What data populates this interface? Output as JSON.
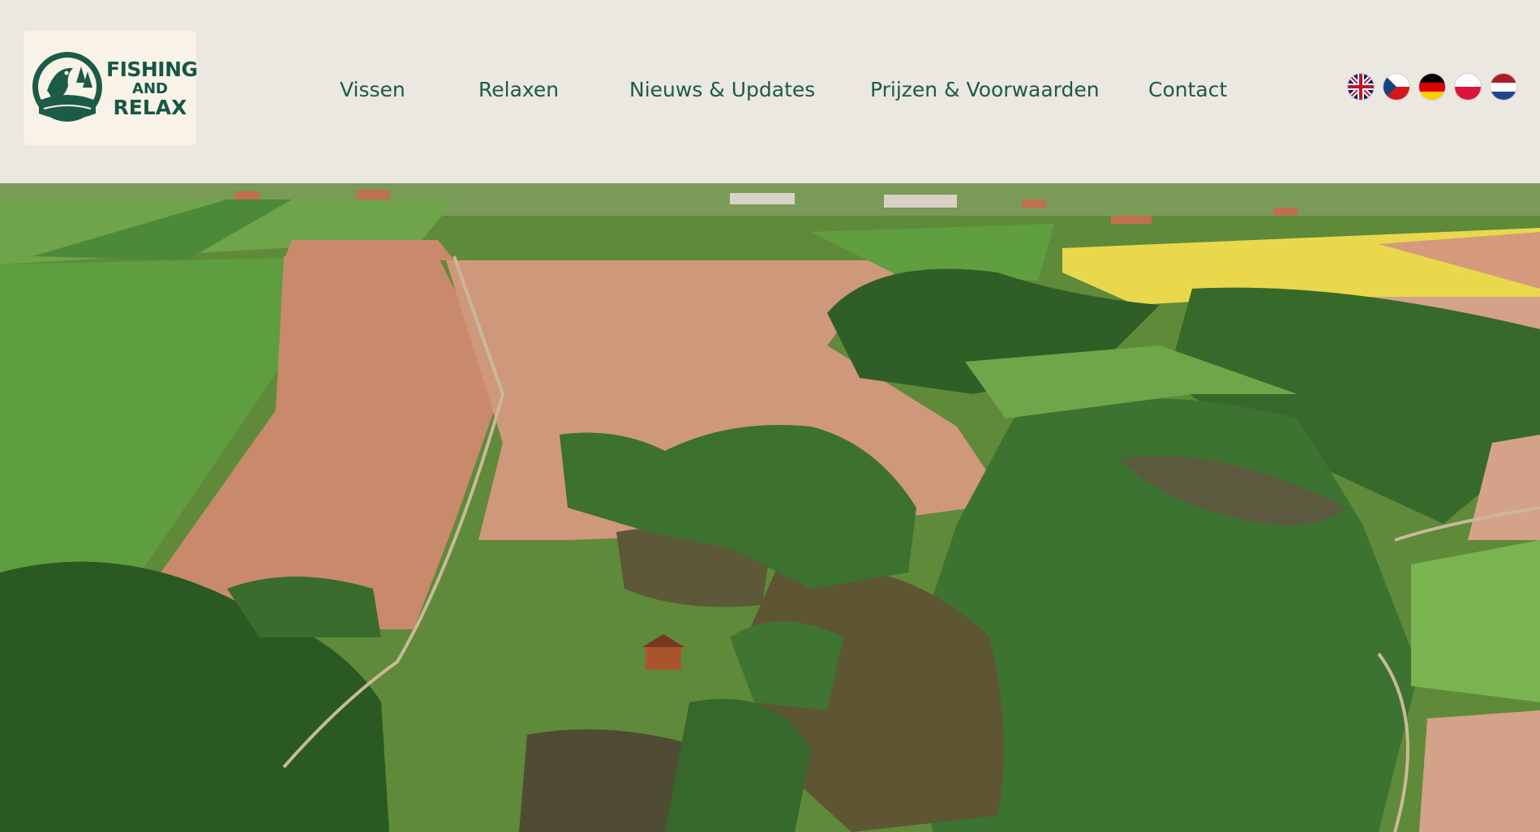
{
  "logo": {
    "line1": "FISHING",
    "line2": "AND",
    "line3": "RELAX",
    "icon": "fish-logo-icon"
  },
  "nav": {
    "items": [
      {
        "label": "Vissen"
      },
      {
        "label": "Relaxen"
      },
      {
        "label": "Nieuws & Updates"
      },
      {
        "label": "Prijzen & Voorwaarden"
      },
      {
        "label": "Contact"
      }
    ]
  },
  "languages": [
    {
      "icon": "flag-uk-icon"
    },
    {
      "icon": "flag-czech-icon"
    },
    {
      "icon": "flag-germany-icon"
    },
    {
      "icon": "flag-poland-icon"
    },
    {
      "icon": "flag-netherlands-icon"
    }
  ],
  "colors": {
    "header_bg": "#ebe7e1",
    "brand_green": "#1d5a48",
    "logo_bg": "#f8f3e6"
  }
}
